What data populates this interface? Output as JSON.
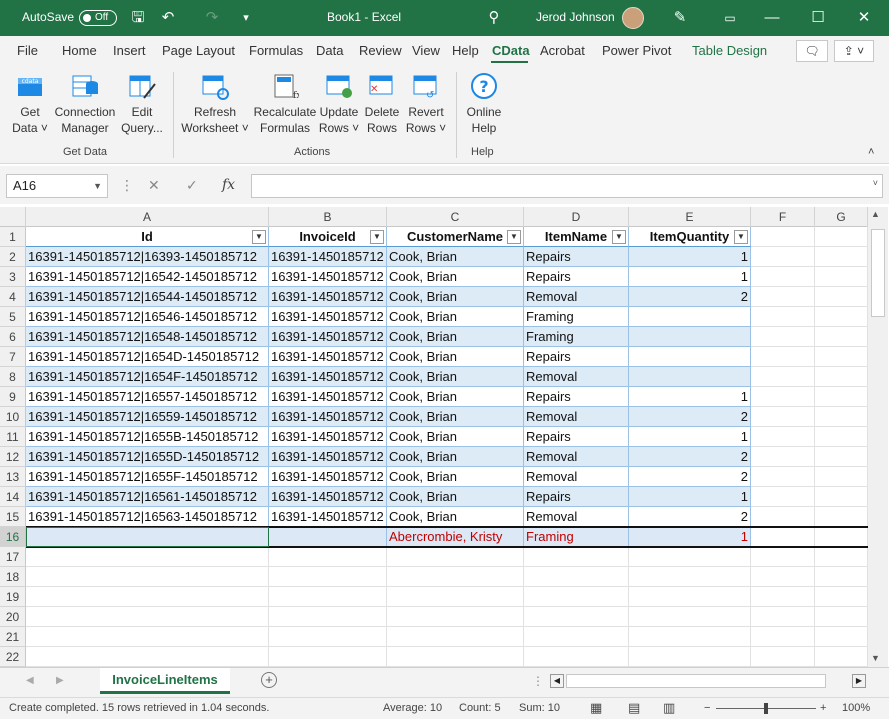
{
  "titlebar": {
    "autosave": "AutoSave",
    "toggle": "Off",
    "title": "Book1  -  Excel",
    "user": "Jerod Johnson",
    "min": "—",
    "max": "☐",
    "close": "✕"
  },
  "tabs": [
    "File",
    "Home",
    "Insert",
    "Page Layout",
    "Formulas",
    "Data",
    "Review",
    "View",
    "Help",
    "CData",
    "Acrobat",
    "Power Pivot",
    "Table Design"
  ],
  "ribbon": {
    "buttons": [
      {
        "l1": "Get",
        "l2": "Data ˅"
      },
      {
        "l1": "Connection",
        "l2": "Manager"
      },
      {
        "l1": "Edit",
        "l2": "Query..."
      },
      {
        "l1": "Refresh",
        "l2": "Worksheet ˅"
      },
      {
        "l1": "Recalculate",
        "l2": "Formulas"
      },
      {
        "l1": "Update",
        "l2": "Rows ˅"
      },
      {
        "l1": "Delete",
        "l2": "Rows"
      },
      {
        "l1": "Revert",
        "l2": "Rows ˅"
      },
      {
        "l1": "Online",
        "l2": "Help"
      }
    ],
    "groups": [
      "Get Data",
      "Actions",
      "Help"
    ]
  },
  "formulabar": {
    "namebox": "A16",
    "fx": "fx",
    "value": ""
  },
  "columns": [
    "A",
    "B",
    "C",
    "D",
    "E",
    "F",
    "G"
  ],
  "table": {
    "headers": [
      "Id",
      "InvoiceId",
      "CustomerName",
      "ItemName",
      "ItemQuantity"
    ],
    "rows": [
      [
        "16391-1450185712|16393-1450185712",
        "16391-1450185712",
        "Cook, Brian",
        "Repairs",
        "1"
      ],
      [
        "16391-1450185712|16542-1450185712",
        "16391-1450185712",
        "Cook, Brian",
        "Repairs",
        "1"
      ],
      [
        "16391-1450185712|16544-1450185712",
        "16391-1450185712",
        "Cook, Brian",
        "Removal",
        "2"
      ],
      [
        "16391-1450185712|16546-1450185712",
        "16391-1450185712",
        "Cook, Brian",
        "Framing",
        ""
      ],
      [
        "16391-1450185712|16548-1450185712",
        "16391-1450185712",
        "Cook, Brian",
        "Framing",
        ""
      ],
      [
        "16391-1450185712|1654D-1450185712",
        "16391-1450185712",
        "Cook, Brian",
        "Repairs",
        ""
      ],
      [
        "16391-1450185712|1654F-1450185712",
        "16391-1450185712",
        "Cook, Brian",
        "Removal",
        ""
      ],
      [
        "16391-1450185712|16557-1450185712",
        "16391-1450185712",
        "Cook, Brian",
        "Repairs",
        "1"
      ],
      [
        "16391-1450185712|16559-1450185712",
        "16391-1450185712",
        "Cook, Brian",
        "Removal",
        "2"
      ],
      [
        "16391-1450185712|1655B-1450185712",
        "16391-1450185712",
        "Cook, Brian",
        "Repairs",
        "1"
      ],
      [
        "16391-1450185712|1655D-1450185712",
        "16391-1450185712",
        "Cook, Brian",
        "Removal",
        "2"
      ],
      [
        "16391-1450185712|1655F-1450185712",
        "16391-1450185712",
        "Cook, Brian",
        "Removal",
        "2"
      ],
      [
        "16391-1450185712|16561-1450185712",
        "16391-1450185712",
        "Cook, Brian",
        "Repairs",
        "1"
      ],
      [
        "16391-1450185712|16563-1450185712",
        "16391-1450185712",
        "Cook, Brian",
        "Removal",
        "2"
      ],
      [
        "",
        "",
        "Abercrombie, Kristy",
        "Framing",
        "1"
      ]
    ]
  },
  "rownums": [
    "1",
    "2",
    "3",
    "4",
    "5",
    "6",
    "7",
    "8",
    "9",
    "10",
    "11",
    "12",
    "13",
    "14",
    "15",
    "16",
    "17",
    "18",
    "19",
    "20",
    "21",
    "22"
  ],
  "sheettab": "InvoiceLineItems",
  "status": {
    "msg": "Create completed. 15 rows retrieved in 1.04 seconds.",
    "average": "Average: 10",
    "count": "Count: 5",
    "sum": "Sum: 10",
    "zoom": "100%"
  },
  "colors": {
    "accent": "#217346",
    "band": "#ddebf7",
    "new_row_text": "#c00000"
  }
}
